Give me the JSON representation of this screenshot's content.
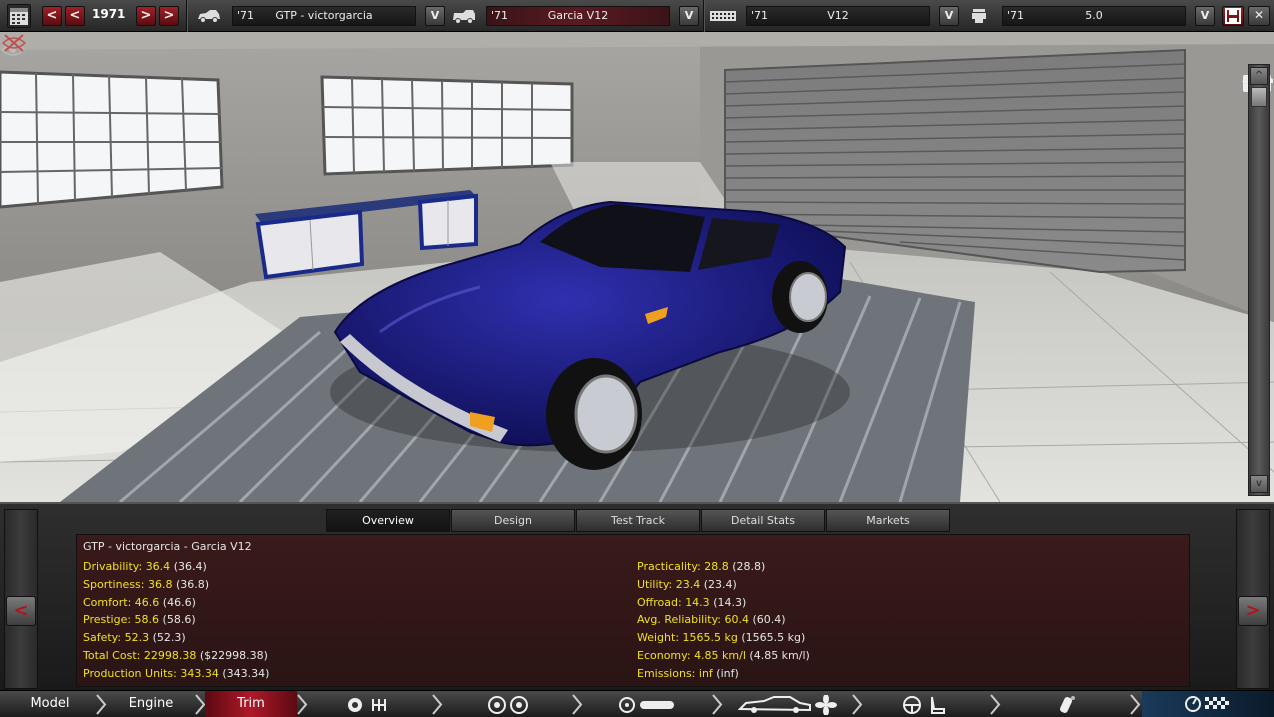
{
  "topbar": {
    "year": "1971",
    "prev_label": "<",
    "next_label": ">",
    "dropdown_label": "V",
    "model": {
      "year": "'71",
      "name": "GTP - victorgarcia"
    },
    "trim": {
      "year": "'71",
      "name": "Garcia V12"
    },
    "engine_family": {
      "year": "'71",
      "name": "V12"
    },
    "engine_variant": {
      "year": "'71",
      "name": "5.0"
    },
    "close_label": "✕"
  },
  "tabs": [
    "Overview",
    "Design",
    "Test Track",
    "Detail Stats",
    "Markets"
  ],
  "active_tab": "Overview",
  "stats": {
    "title": "GTP - victorgarcia - Garcia V12",
    "left": [
      {
        "key": "Drivability:",
        "value": "36.4",
        "prev": "(36.4)"
      },
      {
        "key": "Sportiness:",
        "value": "36.8",
        "prev": "(36.8)"
      },
      {
        "key": "Comfort:",
        "value": "46.6",
        "prev": "(46.6)"
      },
      {
        "key": "Prestige:",
        "value": "58.6",
        "prev": "(58.6)"
      },
      {
        "key": "Safety:",
        "value": "52.3",
        "prev": "(52.3)"
      },
      {
        "key": "Total Cost:",
        "value": "22998.38",
        "prev": "($22998.38)"
      },
      {
        "key": "Production Units:",
        "value": "343.34",
        "prev": "(343.34)"
      }
    ],
    "right": [
      {
        "key": "Practicality:",
        "value": "28.8",
        "prev": "(28.8)"
      },
      {
        "key": "Utility:",
        "value": "23.4",
        "prev": "(23.4)"
      },
      {
        "key": "Offroad:",
        "value": "14.3",
        "prev": "(14.3)"
      },
      {
        "key": "Avg. Reliability:",
        "value": "60.4",
        "prev": "(60.4)"
      },
      {
        "key": "Weight:",
        "value": "1565.5 kg",
        "prev": "(1565.5 kg)"
      },
      {
        "key": "Economy:",
        "value": "4.85 km/l",
        "prev": "(4.85 km/l)"
      },
      {
        "key": "Emissions:",
        "value": "inf",
        "prev": "(inf)"
      }
    ]
  },
  "panel_nav": {
    "left": "<",
    "right": ">"
  },
  "categories": {
    "model": "Model",
    "engine": "Engine",
    "trim": "Trim"
  },
  "colors": {
    "car_body": "#1a1a7a",
    "accent_red": "#b01828",
    "stat_yellow": "#f0e020"
  }
}
